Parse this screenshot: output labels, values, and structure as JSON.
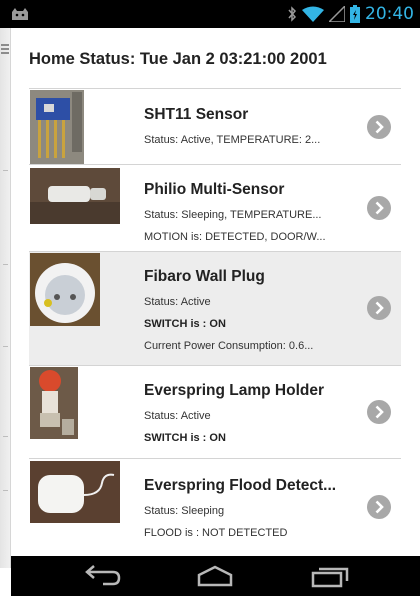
{
  "status_bar": {
    "time": "20:40",
    "icons": [
      "android-cat-icon",
      "bluetooth-icon",
      "wifi-icon",
      "signal-icon",
      "battery-icon"
    ],
    "time_color": "#33b5e5"
  },
  "header": {
    "title": "Home Status: Tue Jan 2 03:21:00 2001"
  },
  "devices": [
    {
      "name": "SHT11 Sensor",
      "lines": [
        "Status: Active, TEMPERATURE: 2..."
      ],
      "bold_lines": [],
      "icon": "sht11-sensor-photo"
    },
    {
      "name": "Philio Multi-Sensor",
      "lines": [
        "Status: Sleeping, TEMPERATURE...",
        "MOTION is: DETECTED, DOOR/W..."
      ],
      "icon": "philio-multisensor-photo"
    },
    {
      "name": "Fibaro Wall Plug",
      "lines": [
        "Status: Active",
        "SWITCH is : ON",
        "Current Power Consumption: 0.6..."
      ],
      "icon": "fibaro-wall-plug-photo"
    },
    {
      "name": "Everspring Lamp Holder",
      "lines": [
        "Status: Active",
        "SWITCH is : ON"
      ],
      "icon": "everspring-lamp-holder-photo"
    },
    {
      "name": "Everspring Flood Detect...",
      "lines": [
        "Status: Sleeping",
        "FLOOD is : NOT DETECTED"
      ],
      "icon": "everspring-flood-detector-photo"
    }
  ],
  "nav": {
    "icons": [
      "back-icon",
      "home-icon",
      "recent-apps-icon"
    ]
  },
  "colors": {
    "accent": "#33b5e5",
    "arrow_circle": "#a8a8a8",
    "highlight_row": "#ededed"
  }
}
